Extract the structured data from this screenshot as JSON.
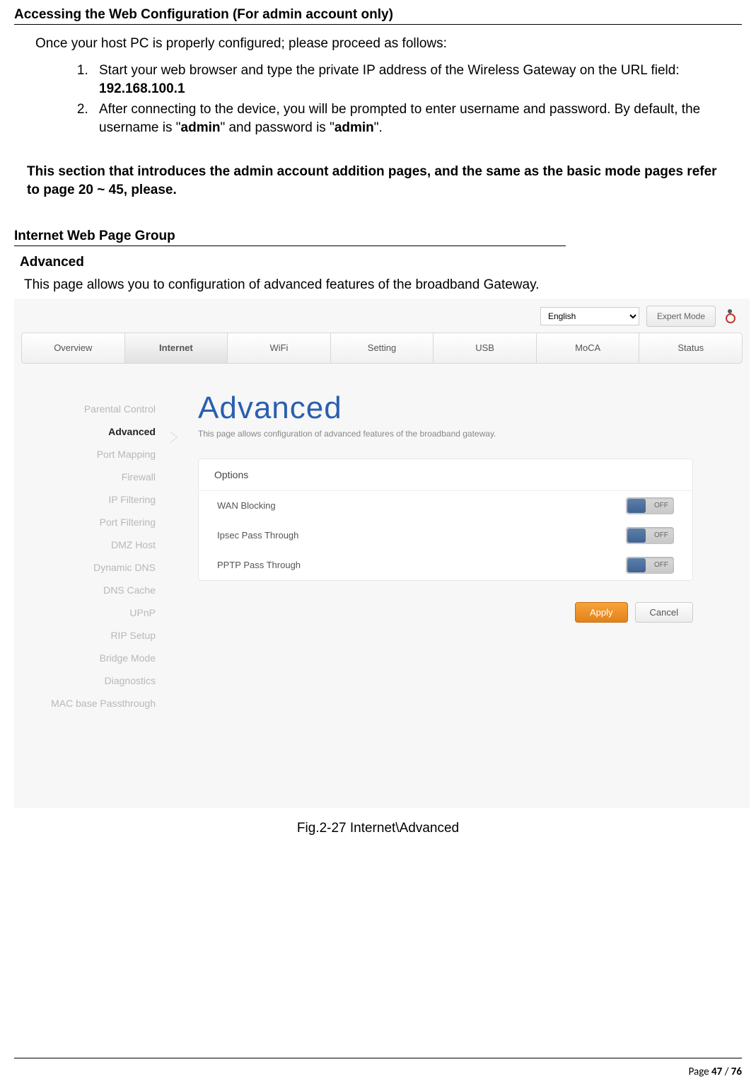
{
  "doc": {
    "h1": "Accessing the Web Configuration (For admin account only)",
    "intro": "Once your host PC is properly configured; please proceed as follows:",
    "step1_a": "Start your web browser and type the private IP address of the Wireless Gateway on the URL field: ",
    "step1_ip": "192.168.100.1",
    "step2_a": "After connecting to the device, you will be prompted to enter username and password. By default, the username is \"",
    "step2_u": "admin",
    "step2_b": "\" and password is \"",
    "step2_p": "admin",
    "step2_c": "\".",
    "note": "This section that introduces the admin account addition pages, and the same as the basic mode pages refer to page 20 ~ 45, please.",
    "h2": "Internet Web Page Group",
    "sub": "Advanced",
    "desc": "This page allows you to configuration of advanced features of the broadband Gateway.",
    "figcap": "Fig.2-27 Internet\\Advanced",
    "page_a": "Page ",
    "page_n": "47",
    "page_b": " / ",
    "page_t": "76"
  },
  "ui": {
    "lang": "English",
    "mode_btn": "Expert Mode",
    "tabs": [
      "Overview",
      "Internet",
      "WiFi",
      "Setting",
      "USB",
      "MoCA",
      "Status"
    ],
    "active_tab": 1,
    "side": [
      "Parental Control",
      "Advanced",
      "Port Mapping",
      "Firewall",
      "IP Filtering",
      "Port Filtering",
      "DMZ Host",
      "Dynamic DNS",
      "DNS Cache",
      "UPnP",
      "RIP Setup",
      "Bridge Mode",
      "Diagnostics",
      "MAC base Passthrough"
    ],
    "active_side": 1,
    "panel_title": "Advanced",
    "panel_desc": "This page allows configuration of advanced features of the broadband gateway.",
    "options_head": "Options",
    "opts": [
      {
        "label": "WAN Blocking",
        "state": "OFF"
      },
      {
        "label": "Ipsec Pass Through",
        "state": "OFF"
      },
      {
        "label": "PPTP Pass Through",
        "state": "OFF"
      }
    ],
    "apply": "Apply",
    "cancel": "Cancel"
  }
}
